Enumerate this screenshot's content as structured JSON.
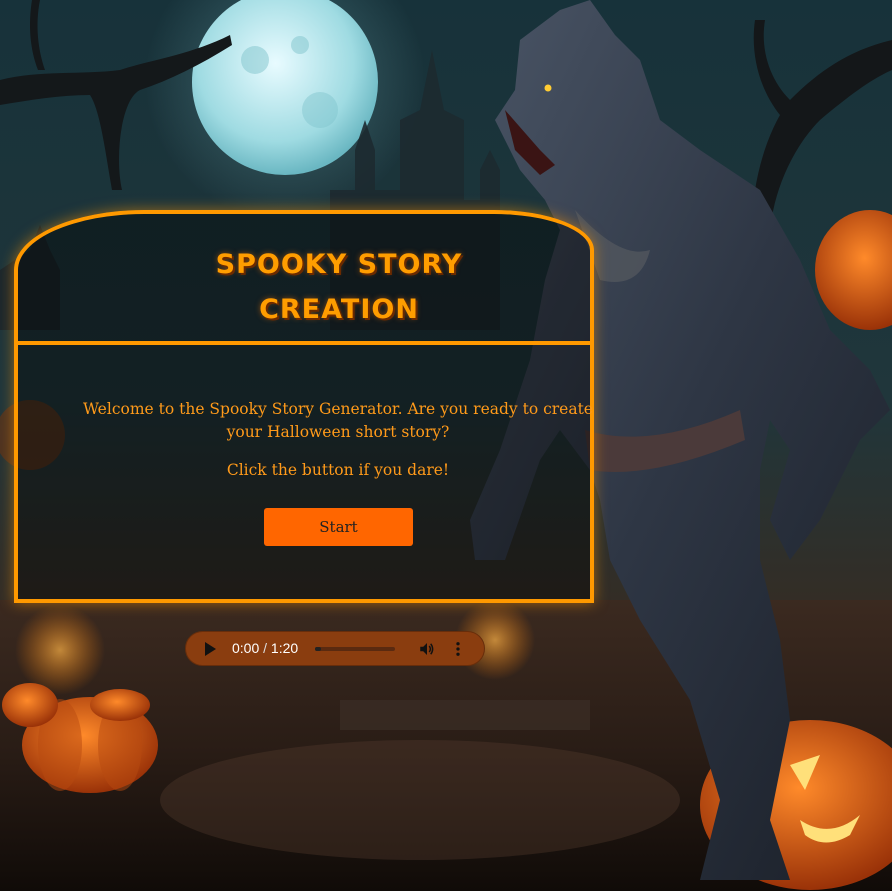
{
  "card": {
    "title_line1": "SPOOKY STORY",
    "title_line2": "CREATION",
    "welcome_text": "Welcome to the Spooky Story Generator. Are you ready to create your Halloween short story?",
    "dare_text": "Click the button if you dare!",
    "start_label": "Start"
  },
  "audio": {
    "current_time": "0:00",
    "separator": " / ",
    "duration": "1:20",
    "progress": 0.0
  },
  "colors": {
    "accent": "#ff9900",
    "button": "#ff6600",
    "audio_bg": "#8a3d0f"
  },
  "icons": [
    "play-icon",
    "volume-icon",
    "more-options-icon"
  ]
}
